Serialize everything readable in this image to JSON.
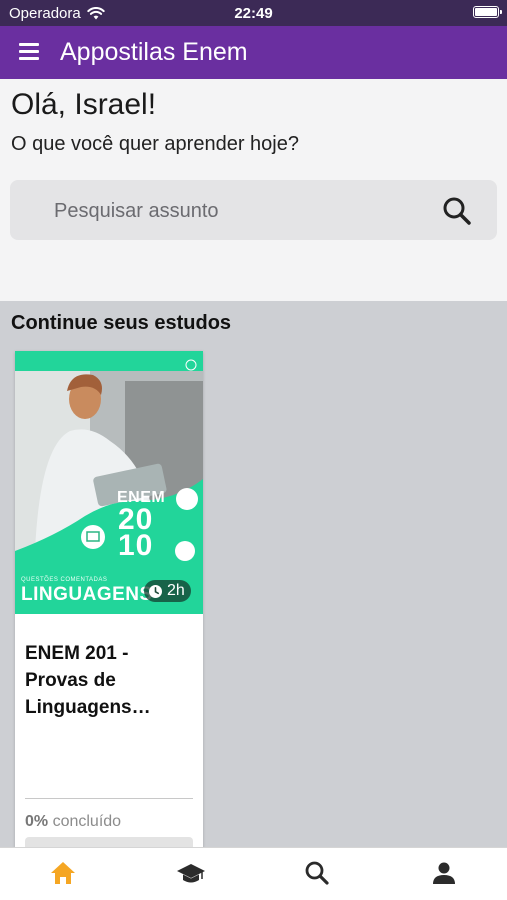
{
  "status_bar": {
    "carrier": "Operadora",
    "time": "22:49"
  },
  "app_bar": {
    "title": "Appostilas Enem",
    "menu_icon": "menu-icon"
  },
  "greeting": "Olá, Israel!",
  "subtitle": "O que você quer aprender hoje?",
  "search": {
    "placeholder": "Pesquisar assunto",
    "value": "",
    "icon": "search-icon"
  },
  "continue_section": {
    "title": "Continue seus estudos",
    "courses": [
      {
        "cover": {
          "label_top": "ENEM",
          "year_line1": "20",
          "year_line2": "10",
          "small_caption": "QUESTÕES COMENTADAS",
          "subject": "LINGUAGENS",
          "accent_color": "#22d59a"
        },
        "duration": "2h",
        "title": "ENEM 201 - Provas de Linguagens…",
        "progress_percent": "0%",
        "progress_suffix": "concluído",
        "progress_value": 0
      }
    ]
  },
  "bottom_nav": {
    "items": [
      {
        "icon": "home-icon",
        "active": true
      },
      {
        "icon": "graduation-cap-icon",
        "active": false
      },
      {
        "icon": "search-icon",
        "active": false
      },
      {
        "icon": "user-icon",
        "active": false
      }
    ]
  },
  "colors": {
    "status_bar": "#3c2a56",
    "app_bar": "#6a2fa0",
    "nav_active": "#f5a623",
    "nav_inactive": "#2b2b2b"
  }
}
